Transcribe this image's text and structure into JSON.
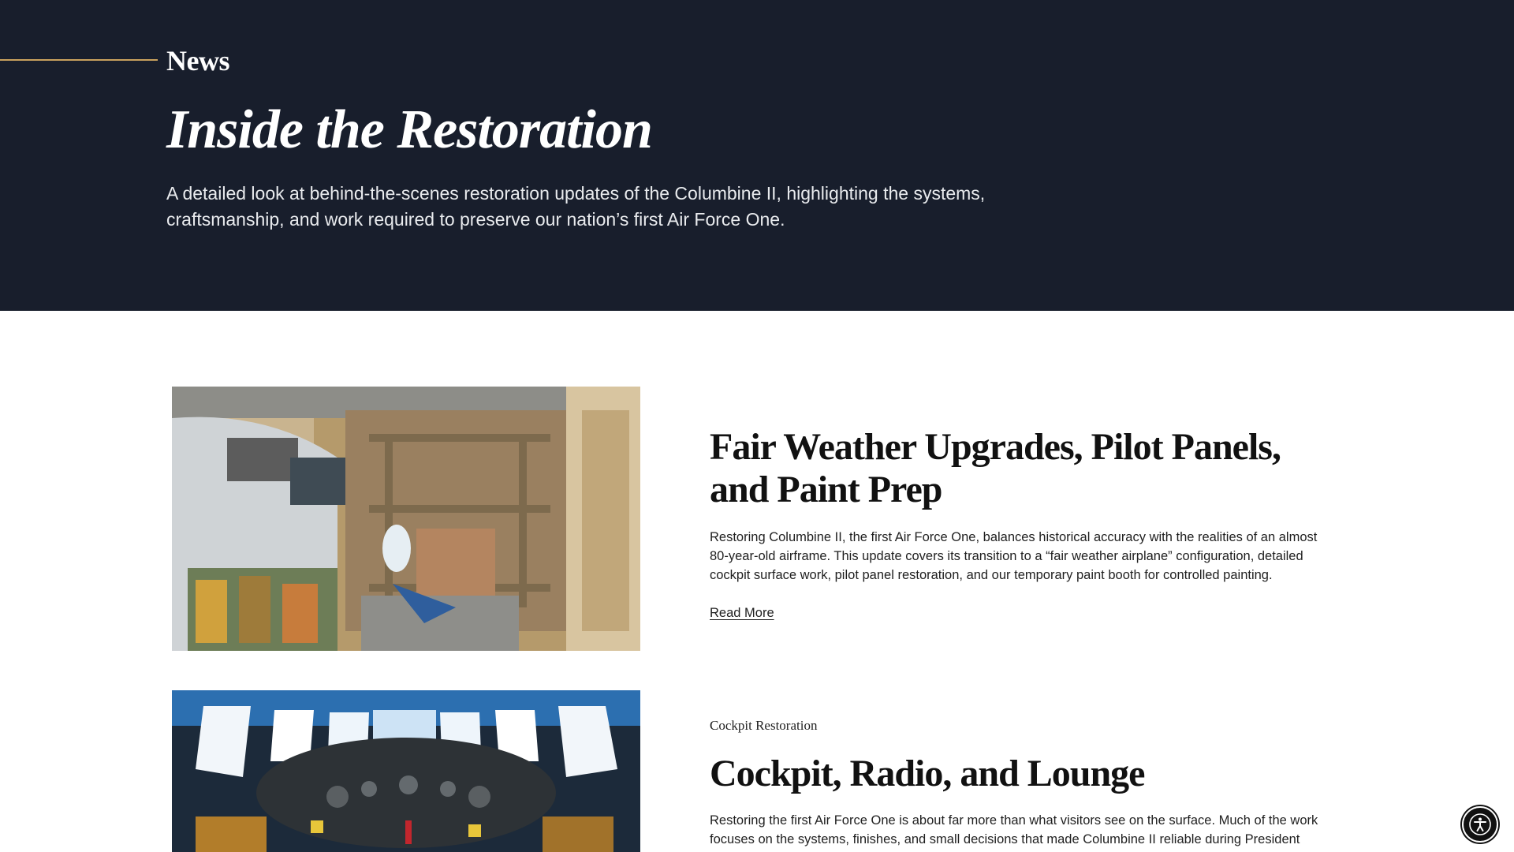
{
  "hero": {
    "eyebrow": "News",
    "title": "Inside the Restoration",
    "description": "A detailed look at behind-the-scenes restoration updates of the Columbine II, highlighting the systems, craftsmanship, and work required to preserve our nation’s first Air Force One."
  },
  "articles": [
    {
      "category": "",
      "title": "Fair Weather Upgrades, Pilot Panels, and Paint Prep",
      "excerpt": "Restoring Columbine II, the first Air Force One, balances historical accuracy with the realities of an almost 80-year-old airframe. This update covers its transition to a “fair weather airplane” configuration, detailed cockpit surface work, pilot panel restoration, and our temporary paint booth for controlled painting.",
      "link_label": "Read More"
    },
    {
      "category": "Cockpit Restoration",
      "title": "Cockpit, Radio, and Lounge",
      "excerpt": "Restoring the first Air Force One is about far more than what visitors see on the surface. Much of the work focuses on the systems, finishes, and small decisions that made Columbine II reliable during President"
    }
  ],
  "colors": {
    "hero_bg": "#181e2c",
    "accent_rule": "#c9a15d",
    "text_dark": "#111111"
  },
  "icons": {
    "accessibility": "accessibility-icon"
  }
}
